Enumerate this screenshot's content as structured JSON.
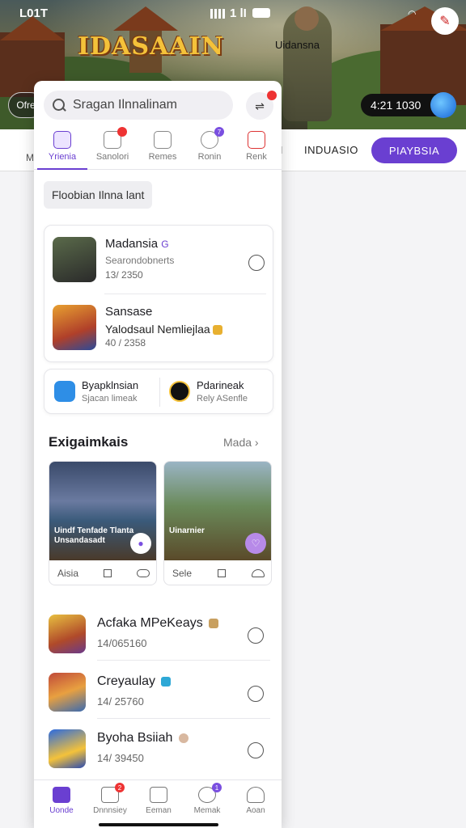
{
  "status_bar": {
    "time": "L01T",
    "right_text": "1 lI",
    "signal": "signal-icon",
    "battery": "battery-icon"
  },
  "banner": {
    "game_logo": "IDASAAIN",
    "character_label": "Uidansna",
    "left_chip": "Ofre",
    "timer": "4:21 1030"
  },
  "bg_tabs": {
    "left_fragment": "M",
    "separator": "I",
    "industry": "INDUASIO",
    "play_button": "PIAYBSIA"
  },
  "search": {
    "placeholder": "Sragan Ilnnalinam"
  },
  "category_tabs": [
    {
      "label": "Yrienia",
      "active": true,
      "badge": ""
    },
    {
      "label": "Sanolori",
      "active": false,
      "badge": ""
    },
    {
      "label": "Remes",
      "active": false,
      "badge": ""
    },
    {
      "label": "Ronin",
      "active": false,
      "badge": "7"
    },
    {
      "label": "Renk",
      "active": false,
      "badge": ""
    }
  ],
  "filter_chip": "Floobian Ilnna lant",
  "featured_games": [
    {
      "name": "Madansia",
      "sub": "Searondobnerts",
      "count": "13/ 2350"
    },
    {
      "name": "Sansase",
      "sub": "Yalodsaul Nemliejlaa",
      "count": "40 / 2358"
    }
  ],
  "mini_cards": [
    {
      "title": "Byapklnsian",
      "sub": "Sjacan limeak"
    },
    {
      "title": "Pdarineak",
      "sub": "Rely ASenfle"
    }
  ],
  "section": {
    "title": "Exigaimkais",
    "more": "Mada"
  },
  "feature_cards": [
    {
      "caption": "Uindf Tenfade Tlanta Unsandasadt",
      "foot_label": "Aisia"
    },
    {
      "caption": "Uinarnier",
      "foot_label": "Sele"
    }
  ],
  "game_list": [
    {
      "name": "Acfaka MPeKeays",
      "count": "14/065160"
    },
    {
      "name": "Creyaulay",
      "count": "14/ 25760"
    },
    {
      "name": "Byoha Bsiiah",
      "count": "14/ 39450"
    }
  ],
  "bottom_nav": [
    {
      "label": "Uonde",
      "active": true,
      "badge": ""
    },
    {
      "label": "Dnnnsiey",
      "active": false,
      "badge": "2"
    },
    {
      "label": "Eeman",
      "active": false,
      "badge": ""
    },
    {
      "label": "Memak",
      "active": false,
      "badge": "1"
    },
    {
      "label": "Aoan",
      "active": false,
      "badge": ""
    }
  ],
  "colors": {
    "accent": "#6a3fd1",
    "badge_red": "#e33333"
  }
}
